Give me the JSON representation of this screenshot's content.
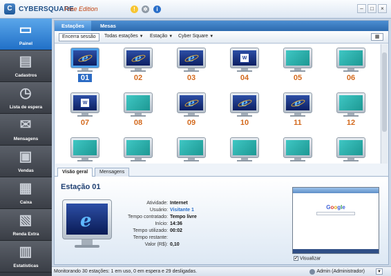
{
  "app": {
    "brand": "CYBERSQUARE",
    "edition": "Free Edition"
  },
  "sidebar": {
    "items": [
      {
        "label": "Painel",
        "icon": "monitor-icon",
        "active": true
      },
      {
        "label": "Cadastros",
        "icon": "id-card-icon",
        "active": false
      },
      {
        "label": "Lista de espera",
        "icon": "clock-icon",
        "active": false
      },
      {
        "label": "Mensagens",
        "icon": "envelope-icon",
        "active": false
      },
      {
        "label": "Vendas",
        "icon": "basket-icon",
        "active": false
      },
      {
        "label": "Caixa",
        "icon": "calculator-icon",
        "active": false
      },
      {
        "label": "Renda Extra",
        "icon": "money-icon",
        "active": false
      },
      {
        "label": "Estatísticas",
        "icon": "bar-chart-icon",
        "active": false
      }
    ]
  },
  "tabs": [
    "Estações",
    "Mesas"
  ],
  "toolbar": {
    "end_session": "Encerra sessão",
    "filter_all": "Todas estações",
    "filter_station": "Estação",
    "filter_cyber": "Cyber Square"
  },
  "stations": [
    {
      "num": "01",
      "state": "ie",
      "selected": true
    },
    {
      "num": "02",
      "state": "ie"
    },
    {
      "num": "03",
      "state": "ie"
    },
    {
      "num": "04",
      "state": "word"
    },
    {
      "num": "05",
      "state": "off"
    },
    {
      "num": "06",
      "state": "off"
    },
    {
      "num": "07",
      "state": "word"
    },
    {
      "num": "08",
      "state": "off"
    },
    {
      "num": "09",
      "state": "ie"
    },
    {
      "num": "10",
      "state": "ie"
    },
    {
      "num": "11",
      "state": "ie"
    },
    {
      "num": "12",
      "state": "off"
    },
    {
      "num": "",
      "state": "off"
    },
    {
      "num": "",
      "state": "off"
    },
    {
      "num": "",
      "state": "off"
    },
    {
      "num": "",
      "state": "off"
    },
    {
      "num": "",
      "state": "off"
    },
    {
      "num": "",
      "state": "off"
    }
  ],
  "detail_tabs": [
    "Visão geral",
    "Mensagens"
  ],
  "detail": {
    "title": "Estação 01",
    "rows": [
      {
        "label": "Atividade:",
        "value": "Internet",
        "link": false
      },
      {
        "label": "Usuário:",
        "value": "Visitante 1",
        "link": true
      },
      {
        "label": "Tempo contratado:",
        "value": "Tempo livre",
        "link": false
      },
      {
        "label": "Início:",
        "value": "14:36",
        "link": false
      },
      {
        "label": "Tempo utilizado:",
        "value": "00:02",
        "link": false
      },
      {
        "label": "Tempo restante:",
        "value": "",
        "link": false
      },
      {
        "label": "Valor (R$):",
        "value": "0,10",
        "link": false
      }
    ],
    "screenshot_logo": "Google",
    "visualize_label": "Visualizar",
    "visualize_checked": true
  },
  "status": {
    "text": "Monitorando 30 estações: 1 em uso, 0 em espera e 29 desligadas.",
    "user": "Admin (Administrador)"
  }
}
